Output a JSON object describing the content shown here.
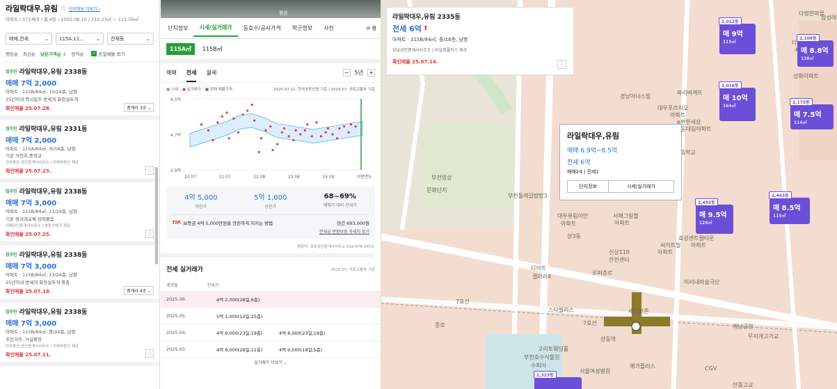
{
  "left": {
    "title": "라일락대우,유림",
    "star": "☆",
    "sub_link": "단지정보 더보기 ›",
    "meta": "아파트 / 572세대 / 총 8동 / 2002.08.10 / 115.23㎡ ~ 115.59㎡",
    "filters": [
      "매매,전세",
      "115A,11...",
      "전체동"
    ],
    "sorts": [
      "랭킹순",
      "최신순",
      "낮은가격순 ↓",
      "면적순"
    ],
    "same_label": "동일매물 묶기",
    "items": [
      {
        "tag": "집주인",
        "name": "라일락대우,유림 2338동",
        "price": "매매 7억 2,000",
        "d1": "아파트 · 115B/84㎡, 10/24층, 남향",
        "d2": "25년이내  즉시입주 방세개  화장실두개",
        "badge": "",
        "extra": "",
        "confirm": "확인매물 25.07.28.",
        "count": "중개사 3곳 ⌄"
      },
      {
        "tag": "집주인",
        "name": "라일락대우,유림 2331동",
        "price": "매매 7억 2,000",
        "d1": "아파트 · 115A/84㎡, 저/16층, 남향",
        "d2": "기본 석천초,중학교",
        "badge": "",
        "extra": "진부동산 공인중개사사무소 | 미래부동산 제공",
        "confirm": "확인매물 25.07.23.",
        "count": ""
      },
      {
        "tag": "집주인",
        "name": "라일락대우,유림 2338동",
        "price": "매매 7억 3,000",
        "d1": "아파트 · 115B/84㎡, 11/24층, 남향",
        "d2": "기본 링크대교체 상태좋음",
        "badge": "",
        "extra": "서해공인중개사사무소 | 부동산뱅크 제공",
        "confirm": "확인매물 25.07.25.",
        "count": ""
      },
      {
        "tag": "집주인",
        "name": "라일락대우,유림 2338동",
        "price": "매매 7억 3,000",
        "d1": "아파트 · 115B/84㎡, 13/24층, 남향",
        "d2": "25년이내  방세개  화장실두개  중층",
        "badge": "",
        "extra": "",
        "confirm": "확인매물 25.07.18.",
        "count": "중개사 4곳 ⌄"
      },
      {
        "tag": "집주인",
        "name": "라일락대우,유림 2338동",
        "price": "매매 7억 3,000",
        "d1": "아파트 · 115B/84㎡, 중/24층, 남향",
        "d2": "주인거주, 거실확장",
        "badge": "",
        "extra": "진부동산 공인중개사사무소 | 미래부동산 제공",
        "confirm": "확인매물 25.07.11.",
        "count": ""
      }
    ]
  },
  "mid": {
    "photo_label": "평온",
    "tabs": [
      "단지정보",
      "시세/실거래가",
      "동호수/공시가격",
      "학군정보",
      "사진"
    ],
    "refresh": "⟳ 평",
    "areas": [
      "115A㎡",
      "115B㎡"
    ],
    "sub_tabs": [
      "매매",
      "전세",
      "월세"
    ],
    "period": "5년",
    "legend": [
      "시세",
      "실거래가",
      "현재 매물가격"
    ],
    "legend_source": "2025.07.21. 한국부동산원 기준 / 2025.07. 국토교통부 기준",
    "stats": [
      {
        "v": "4억 5,000",
        "l": "하한가"
      },
      {
        "v": "5억 1,000",
        "l": "상한가"
      },
      {
        "v": "68~69%",
        "l": "매매가 대비 전세가"
      }
    ],
    "tip_label": "TIP.",
    "tip": "보증금 4억 5,000만원을 안전하게 지키는 방법",
    "tip_price": "연간 693,000원",
    "tip_link": "전세금 반환보증 자세히 보기",
    "source": "제공처: 호조공인중개사사무소 032-678-2453",
    "trade_title": "전세 실거래가",
    "trade_source": "2025.07. 국토교통부 기준",
    "th": [
      "계약월",
      "전세가"
    ],
    "trades": [
      {
        "m": "2025.06.",
        "a": "4억 2,000(28일,6층)",
        "b": ""
      },
      {
        "m": "2025.05.",
        "a": "5억 1,000(13일,25층)",
        "b": ""
      },
      {
        "m": "2025.04.",
        "a": "4억 8,000(23일,19층)",
        "b": "4억 8,000(23일,19층)"
      },
      {
        "m": "2025.03.",
        "a": "4억 8,000(29일,11층)",
        "b": "4억 9,000(18일,5층)"
      }
    ],
    "more": "실거래가 더보기 ⌄"
  },
  "chart_data": {
    "type": "line",
    "x_ticks": [
      "20.07",
      "21.07",
      "22.08",
      "23.08",
      "24.09",
      "이번연도"
    ],
    "y_ticks": [
      "6.5억",
      "4.7억",
      "2.9억"
    ],
    "ylim": [
      2.9,
      6.5
    ],
    "series": [
      {
        "name": "시세",
        "values": [
          4.4,
          4.6,
          4.8,
          5.0,
          5.3,
          5.4,
          5.2,
          4.9,
          4.8,
          4.7,
          4.6,
          4.7,
          4.8,
          4.9,
          5.0
        ]
      }
    ],
    "points": [
      [
        0.5,
        5.2
      ],
      [
        0.8,
        4.9
      ],
      [
        1.0,
        4.4
      ],
      [
        1.2,
        5.3
      ],
      [
        1.4,
        5.6
      ],
      [
        1.6,
        5.8
      ],
      [
        1.7,
        4.5
      ],
      [
        1.9,
        5.5
      ],
      [
        2.1,
        4.8
      ],
      [
        2.3,
        5.7
      ],
      [
        2.5,
        5.9
      ],
      [
        2.7,
        6.2
      ],
      [
        2.8,
        5.4
      ],
      [
        3.0,
        3.8
      ],
      [
        3.1,
        4.5
      ],
      [
        3.3,
        4.9
      ],
      [
        3.5,
        5.1
      ],
      [
        3.6,
        3.9
      ],
      [
        3.8,
        4.2
      ],
      [
        4.0,
        4.8
      ],
      [
        4.1,
        5.0
      ],
      [
        4.3,
        4.6
      ],
      [
        4.5,
        4.4
      ],
      [
        4.6,
        4.9
      ],
      [
        4.8,
        4.7
      ],
      [
        5.0,
        4.9
      ],
      [
        5.1,
        5.2
      ],
      [
        5.3,
        4.6
      ],
      [
        5.5,
        5.3
      ],
      [
        5.7,
        4.6
      ],
      [
        5.9,
        4.8
      ],
      [
        6.0,
        5.0
      ],
      [
        6.2,
        4.7
      ],
      [
        6.4,
        4.5
      ],
      [
        6.5,
        5.0
      ],
      [
        6.7,
        5.1
      ],
      [
        6.9,
        4.8
      ],
      [
        7.0,
        5.2
      ],
      [
        7.2,
        5.1
      ]
    ]
  },
  "map": {
    "top_card": {
      "title": "라일락대우,유림 2335동",
      "price": "전세 6억",
      "arrow": "⬆",
      "desc": "아파트 · 115B/84㎡, 중/16층, 남향",
      "agency": "강남공인중개사사무소 | 미실정플러스 제공",
      "confirm": "확인매물 25.07.14."
    },
    "popup": {
      "title": "라일락대우,유림",
      "sale": "매매 6.9억~8.5억",
      "rent": "전세 6억",
      "counts": "매매24 | 전세1",
      "btn1": "단지정보",
      "btn2": "시세/실거래가"
    },
    "markers": [
      {
        "top": "2,012동",
        "big": "매 9억",
        "sub": "115㎡"
      },
      {
        "top": "2,108동",
        "big": "매 8.8억",
        "sub": "138㎡"
      },
      {
        "top": "2,016동",
        "big": "매 10억",
        "sub": "164㎡"
      },
      {
        "top": "2,175동",
        "big": "매 7.5억",
        "sub": "114㎡"
      },
      {
        "top": "2,492동",
        "big": "매 9.5억",
        "sub": "126㎡"
      },
      {
        "top": "2,443동",
        "big": "매 8.5억",
        "sub": "115㎡"
      },
      {
        "top": "2,323동",
        "big": "",
        "sub": ""
      }
    ],
    "labels": [
      "다정한마을",
      "삼성래미안아파트",
      "다정한마을",
      "KCC스위첸",
      "파리바게뜨",
      "성화아파트",
      "경남아너스빌",
      "대우푸르지오",
      "아파트",
      "e편한세상",
      "상동대림아파트",
      "석천중학교",
      "부천영상",
      "문화단지",
      "부천둘레길밤방3",
      "대우유림이안",
      "아파트",
      "상3동",
      "서해그랑블",
      "아파트",
      "신상119",
      "안전센터",
      "루퍼츄르",
      "씨이트빌",
      "아파트",
      "효성센트럴타운",
      "아파트",
      "디아뜨",
      "갤러리4",
      "미리내마술극단",
      "스타필리스",
      "세이브존",
      "상동역",
      "고리토웨딩홀",
      "무지개고가교",
      "부천호수식물원",
      "수피아",
      "서울여성병원",
      "메가플러스",
      "CGV",
      "계남공원",
      "안중고교",
      "종로",
      "7호선",
      "7호선"
    ]
  }
}
